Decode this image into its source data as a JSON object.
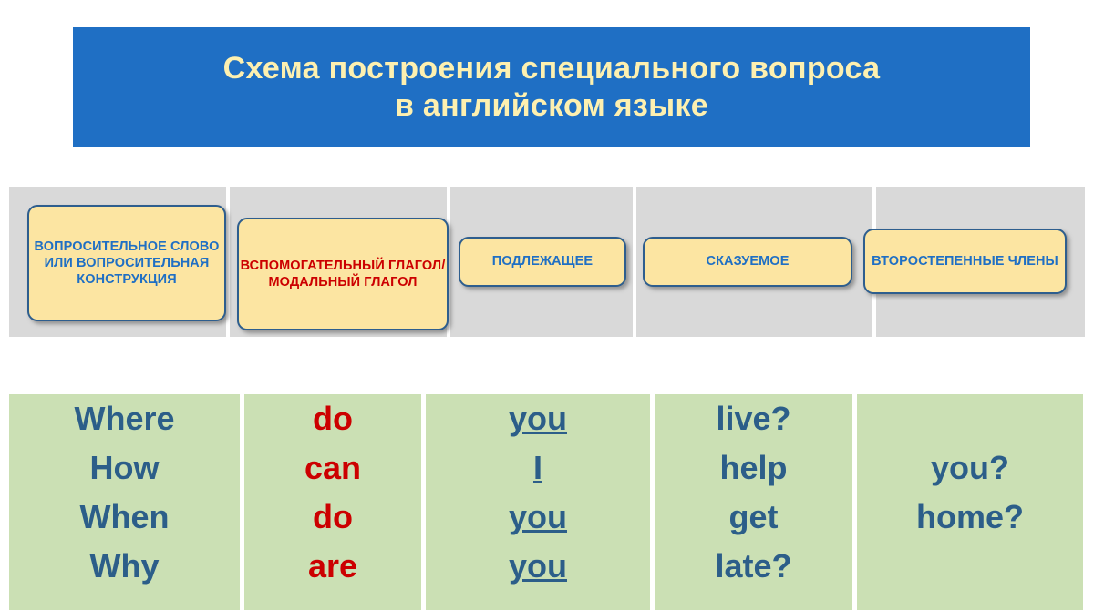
{
  "slide": {
    "title": {
      "line1": "Схема построения специального вопроса",
      "line2": "в английском языке",
      "background_color": "#1F6FC4",
      "text_color": "#FDF0B0"
    },
    "structure": {
      "band_color": "#D9D9D9",
      "box_fill_color": "#FCE5A2",
      "box_border_color": "#2E5E8E",
      "boxes": [
        {
          "label": "ВОПРОСИТЕЛЬНОЕ СЛОВО  ИЛИ ВОПРОСИТЕЛЬНАЯ КОНСТРУКЦИЯ",
          "color": "#1F6FC4"
        },
        {
          "label": "ВСПОМОГАТЕЛЬНЫЙ ГЛАГОЛ/ МОДАЛЬНЫЙ ГЛАГОЛ",
          "color": "#CC0000"
        },
        {
          "label": "ПОДЛЕЖАЩЕЕ",
          "color": "#1F6FC4"
        },
        {
          "label": "СКАЗУЕМОЕ",
          "color": "#1F6FC4"
        },
        {
          "label": "ВТОРОСТЕПЕННЫЕ ЧЛЕНЫ",
          "color": "#1F6FC4"
        }
      ]
    },
    "examples": {
      "cell_color": "#CBE0B4",
      "text_color": "#2C5E89",
      "aux_color": "#CC0000",
      "columns": [
        {
          "values": [
            "Where",
            "How",
            "When",
            "Why"
          ]
        },
        {
          "values": [
            "do",
            "can",
            "do",
            "are"
          ]
        },
        {
          "values": [
            "you",
            "I",
            "you",
            "you"
          ]
        },
        {
          "values": [
            "live?",
            "help",
            "get",
            "late?"
          ]
        },
        {
          "values": [
            "",
            "you?",
            "home?",
            ""
          ]
        }
      ]
    }
  }
}
